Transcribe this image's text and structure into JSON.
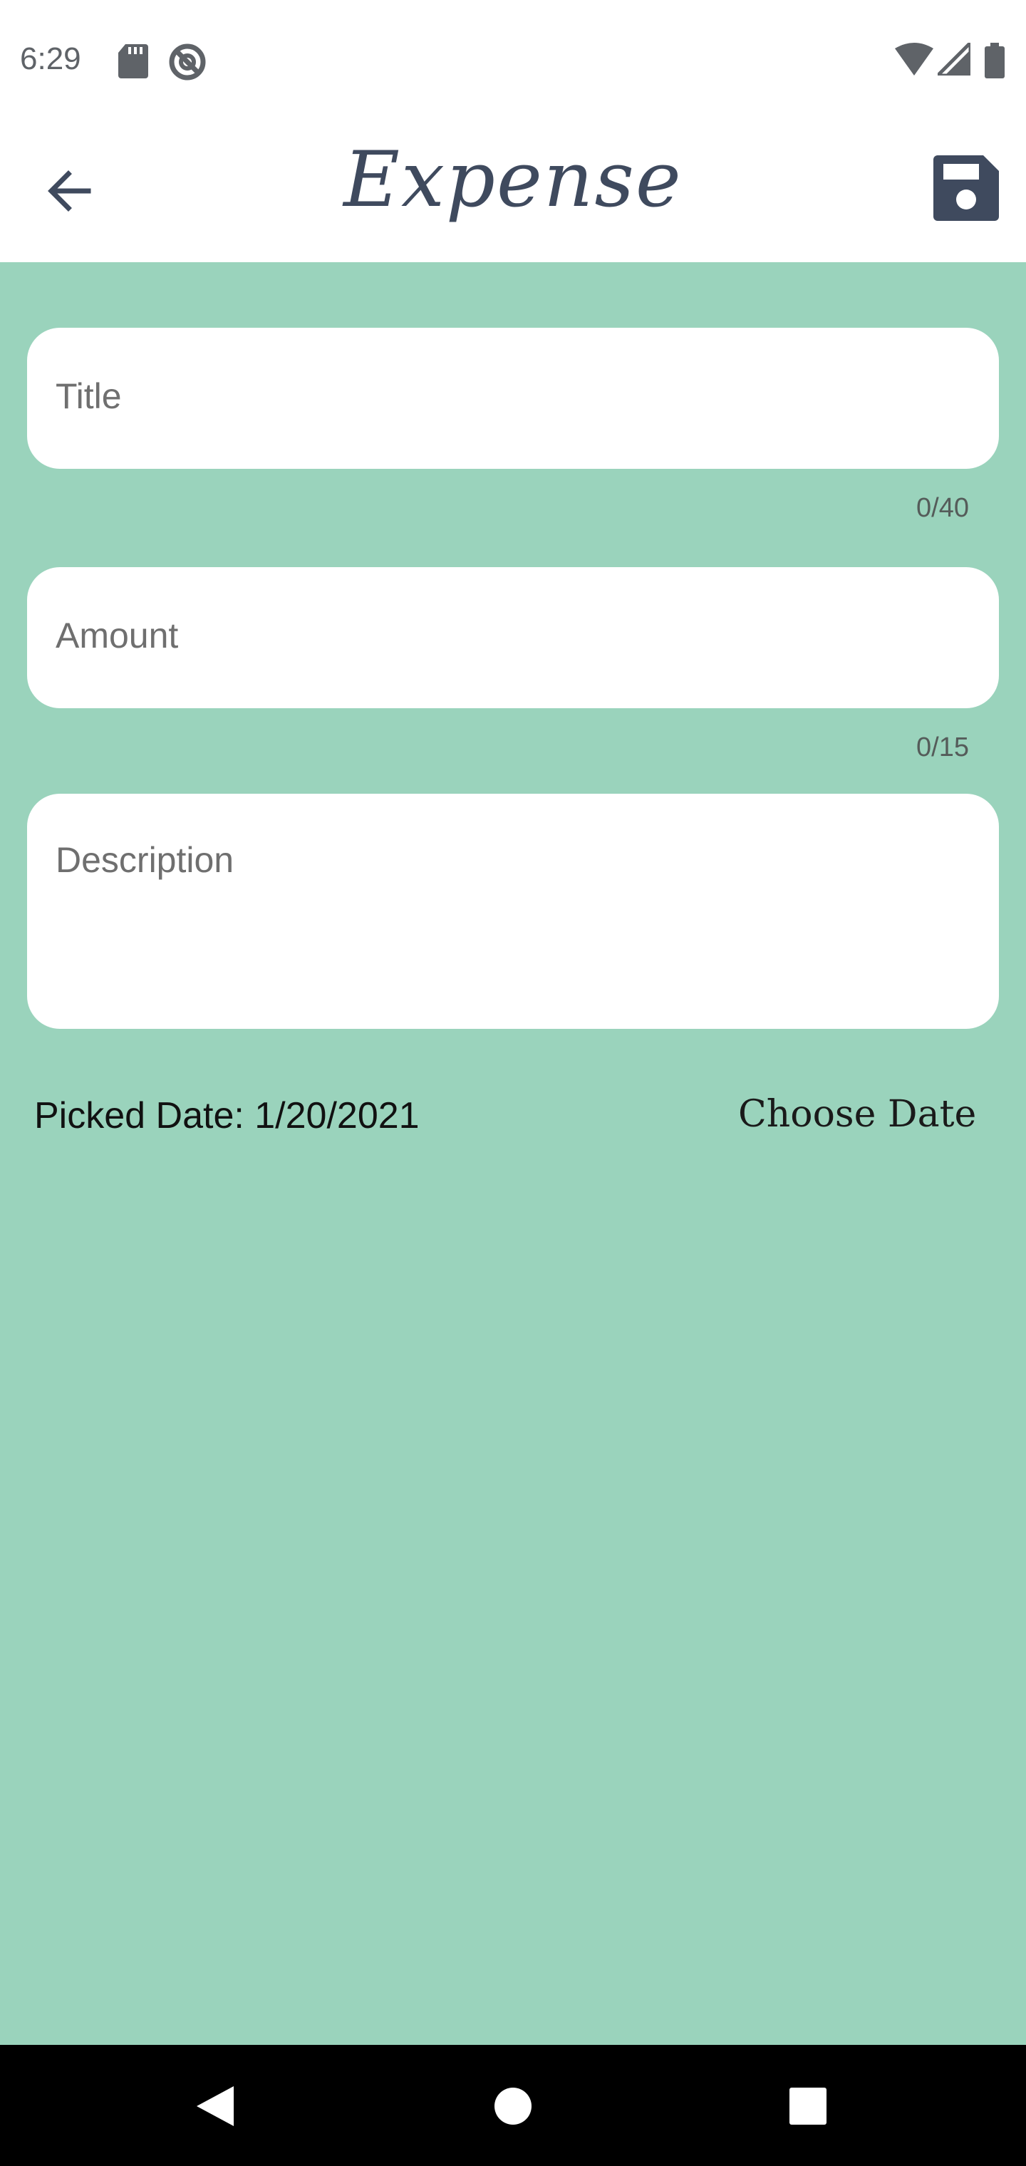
{
  "status_bar": {
    "time": "6:29",
    "icons": [
      "sd-card-icon",
      "do-not-disturb-icon",
      "wifi-icon",
      "signal-icon",
      "battery-icon"
    ]
  },
  "app_bar": {
    "title": "Expense",
    "back_icon": "arrow-back-icon",
    "save_icon": "floppy-save-icon",
    "icon_color": "#3f4a5e"
  },
  "form": {
    "title_field": {
      "placeholder": "Title",
      "value": "",
      "counter": "0/40"
    },
    "amount_field": {
      "placeholder": "Amount",
      "value": "",
      "counter": "0/15"
    },
    "description_field": {
      "placeholder": "Description",
      "value": ""
    },
    "picked_date_text": "Picked Date: 1/20/2021",
    "choose_date_label": "Choose Date"
  },
  "colors": {
    "background": "#9ad3bc",
    "card": "#ffffff",
    "nav_bar": "#000000"
  },
  "nav_bar": {
    "buttons": [
      "back-triangle-icon",
      "home-circle-icon",
      "recents-square-icon"
    ]
  }
}
